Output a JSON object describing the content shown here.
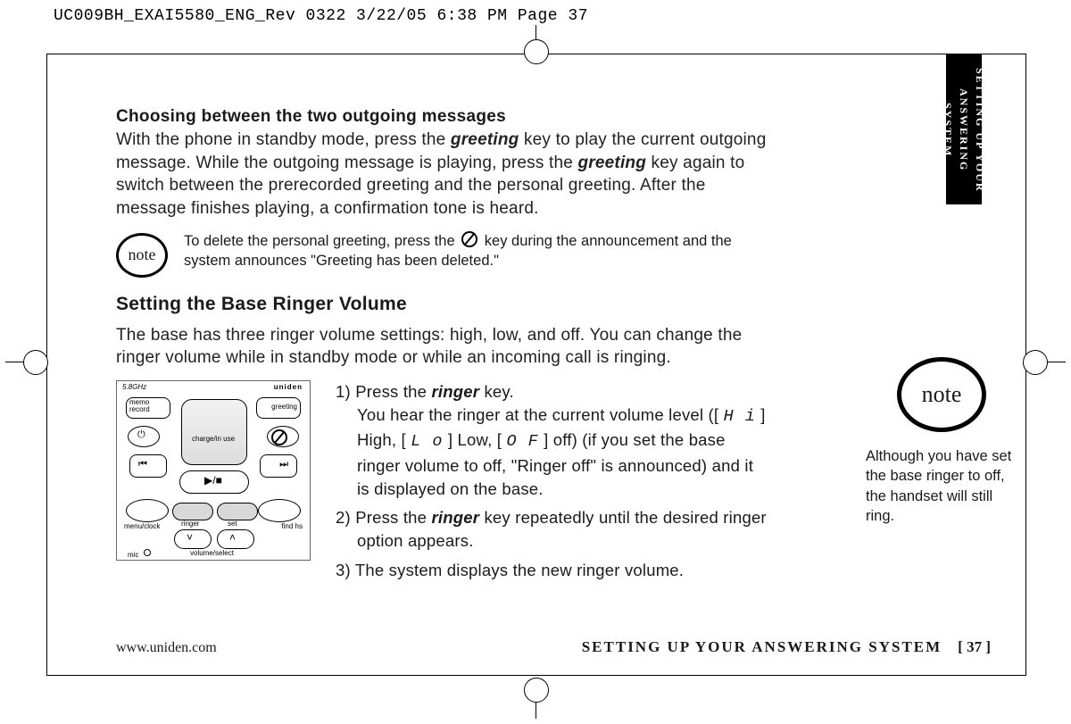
{
  "print_header": "UC009BH_EXAI5580_ENG_Rev 0322  3/22/05  6:38 PM  Page 37",
  "side_tab_line1": "SETTING UP YOUR",
  "side_tab_line2": "ANSWERING SYSTEM",
  "section1": {
    "heading": "Choosing between the two outgoing messages",
    "para_pre": "With the phone in standby mode, press the ",
    "kw1": "greeting",
    "para_mid1": " key to play the current outgoing message. While the outgoing message is playing, press the ",
    "kw2": "greeting",
    "para_post": " key again to switch between the prerecorded greeting and the personal greeting. After the message finishes playing, a confirmation tone is heard."
  },
  "note_label": "note",
  "note1_pre": "To delete the personal greeting, press the ",
  "note1_post": " key during the announcement and the system announces \"Greeting has been deleted.\"",
  "section2": {
    "heading": "Setting the Base Ringer Volume",
    "intro": "The base has three ringer volume settings: high, low, and off. You can change the ringer volume while in standby mode or while an incoming call is ringing.",
    "step1_num": "1) ",
    "step1a": "Press the ",
    "step1_kw": "ringer",
    "step1b": " key.",
    "step1_line2_pre": "You hear the ringer at the current volume level ([ ",
    "seg_hi": "H i",
    "step1_line2_mid1": " ] High, [ ",
    "seg_lo": "L o",
    "step1_line2_mid2": " ] Low, [ ",
    "seg_of": "O F",
    "step1_line2_post": " ] off) (if you set the base ringer volume to off, \"Ringer off\" is announced) and it is displayed on the base.",
    "step2_num": "2) ",
    "step2a": "Press the ",
    "step2_kw": "ringer",
    "step2b": " key repeatedly until the desired ringer option appears.",
    "step3_num": "3) ",
    "step3": "The system displays the new ringer volume."
  },
  "side_note": "Although you have set the base ringer to off, the handset will still ring.",
  "footer": {
    "url": "www.uniden.com",
    "title": "SETTING UP YOUR ANSWERING SYSTEM",
    "page": "[ 37 ]"
  },
  "device": {
    "brand": "uniden",
    "band": "5.8GHz",
    "memo": "memo record",
    "greeting": "greeting",
    "charge": "charge/in use",
    "menu": "menu/clock",
    "ringer": "ringer",
    "set": "set",
    "find": "find hs",
    "volume": "volume/select",
    "mic": "mic"
  }
}
